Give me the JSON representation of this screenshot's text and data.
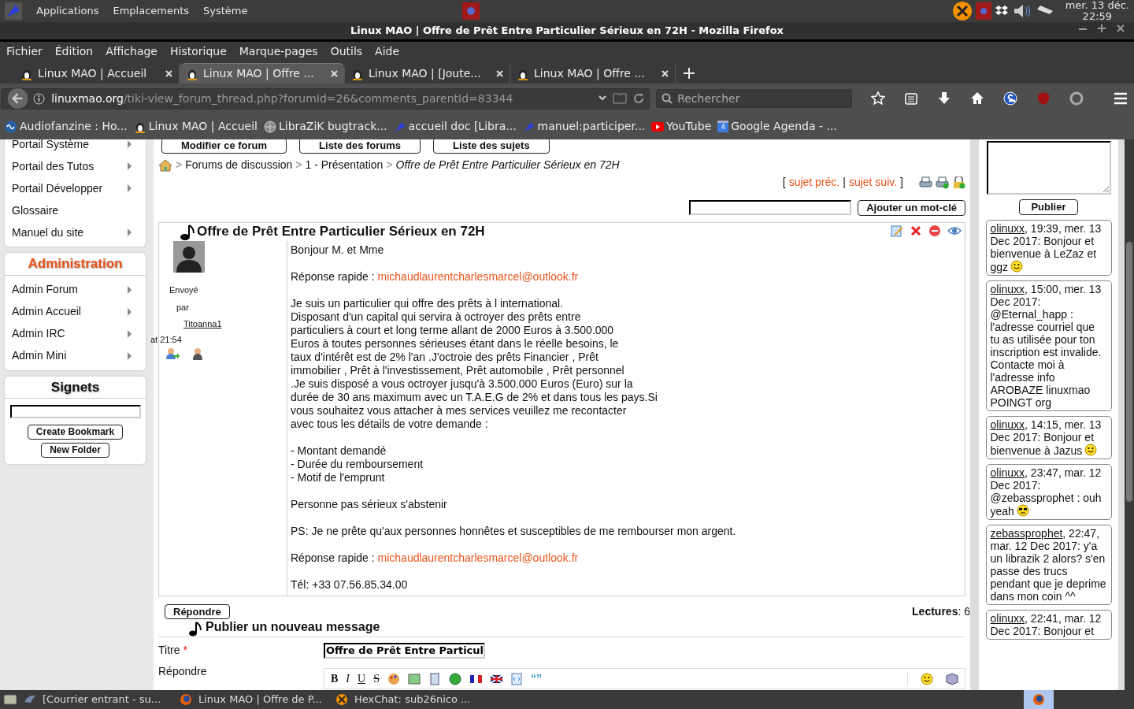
{
  "top_panel": {
    "menus": [
      "Applications",
      "Emplacements",
      "Système"
    ],
    "clock": {
      "day": "mer. 13 déc.",
      "time": "22:59"
    }
  },
  "window": {
    "title": "Linux MAO | Offre de Prêt Entre Particulier Sérieux en 72H - Mozilla Firefox"
  },
  "menubar": [
    "Fichier",
    "Édition",
    "Affichage",
    "Historique",
    "Marque-pages",
    "Outils",
    "Aide"
  ],
  "tabs": [
    {
      "label": "Linux MAO | Accueil",
      "selected": false
    },
    {
      "label": "Linux MAO | Offre ...",
      "selected": true
    },
    {
      "label": "Linux MAO | [Joute...",
      "selected": false
    },
    {
      "label": "Linux MAO | Offre ...",
      "selected": false
    }
  ],
  "address": {
    "domain": "linuxmao.org",
    "path": "/tiki-view_forum_thread.php?forumId=26&comments_parentId=83344"
  },
  "search": {
    "placeholder": "Rechercher"
  },
  "bookmarks": [
    {
      "label": "Audiofanzine : Ho...",
      "kind": "wave"
    },
    {
      "label": "Linux MAO | Accueil",
      "kind": "tux"
    },
    {
      "label": "LibraZiK bugtrack...",
      "kind": "globe"
    },
    {
      "label": "accueil doc [Libra...",
      "kind": "lzk"
    },
    {
      "label": "manuel:participer...",
      "kind": "lzk"
    },
    {
      "label": "YouTube",
      "kind": "play"
    },
    {
      "label": "Google Agenda - ...",
      "kind": "calendar",
      "icon_text": "4"
    }
  ],
  "sidebar": {
    "menu": [
      {
        "label": "Portail Système",
        "submenu": true
      },
      {
        "label": "Portail des Tutos",
        "submenu": true
      },
      {
        "label": "Portail Développer",
        "submenu": true
      },
      {
        "label": "Glossaire",
        "submenu": false
      },
      {
        "label": "Manuel du site",
        "submenu": true
      }
    ],
    "admin": {
      "title": "Administration",
      "items": [
        {
          "label": "Admin Forum",
          "submenu": true
        },
        {
          "label": "Admin Accueil",
          "submenu": true
        },
        {
          "label": "Admin IRC",
          "submenu": true
        },
        {
          "label": "Admin Mini",
          "submenu": true
        }
      ]
    },
    "signets": {
      "title": "Signets",
      "buttons": [
        "Create Bookmark",
        "New Folder"
      ]
    }
  },
  "forum_buttons": [
    "Modifier ce forum",
    "Liste des forums",
    "Liste des sujets"
  ],
  "breadcrumb": [
    {
      "separator": ">",
      "label": "Forums de discussion"
    },
    {
      "separator": ">",
      "label": "1 - Présentation"
    },
    {
      "separator": ">",
      "label": "Offre de Prêt Entre Particulier Sérieux en 72H"
    }
  ],
  "topic_nav": {
    "open": "[",
    "links": [
      "sujet préc.",
      "sujet suiv."
    ],
    "separator": "|",
    "close": "]"
  },
  "keyword": {
    "button": "Ajouter un mot-clé"
  },
  "post": {
    "title": "Offre de Prêt Entre Particulier Sérieux en 72H",
    "sent": "Envoyé",
    "by": "par",
    "author": "Titoanna1",
    "time": "at 21:54",
    "paragraphs": [
      {
        "lines": [
          "Bonjour M. et Mme"
        ]
      },
      {
        "lines": [
          "Réponse rapide : "
        ],
        "link": "michaudlaurentcharlesmarcel@outlook.fr"
      },
      {
        "lines": [
          "Je suis un particulier qui offre des prêts à l international.",
          "Disposant d'un capital qui servira à octroyer des prêts entre",
          "particuliers à court et long terme allant de 2000 Euros à 3.500.000",
          "Euros à toutes personnes sérieuses étant dans le réelle besoins, le",
          "taux d'intérêt est de 2% l'an .J'octroie des prêts Financier , Prêt",
          "immobilier , Prêt à l'investissement, Prêt automobile , Prêt personnel",
          ".Je suis disposé a vous octroyer jusqu'à 3.500.000 Euros (Euro) sur la",
          "durée de 30 ans maximum avec un T.A.E.G de 2% et dans tous les pays.Si",
          "vous souhaitez vous attacher à mes services veuillez me recontacter",
          "avec tous les détails de votre demande :"
        ]
      },
      {
        "lines": [
          "- Montant demandé",
          "- Durée du remboursement",
          "- Motif de l'emprunt"
        ]
      },
      {
        "lines": [
          "Personne pas sérieux s'abstenir"
        ]
      },
      {
        "lines": [
          "PS: Je ne prête qu'aux personnes honnêtes et susceptibles de me rembourser mon argent."
        ]
      },
      {
        "lines": [
          "Réponse rapide : "
        ],
        "link": "michaudlaurentcharlesmarcel@outlook.fr"
      },
      {
        "lines": [
          "Tél: +33 07.56.85.34.00"
        ]
      }
    ]
  },
  "reply_button": "Répondre",
  "reads": {
    "label": "Lectures",
    "value": ": 6"
  },
  "new_message": {
    "heading": "Publier un nouveau message",
    "title_label": "Titre",
    "required": "*",
    "title_value": "Offre de Prêt Entre Particul",
    "reply_label": "Répondre",
    "format_buttons": [
      "B",
      "I",
      "U",
      "S"
    ],
    "quote_glyph": "“”"
  },
  "shoutbox": {
    "button": "Publier",
    "messages": [
      {
        "author": "olinuxx",
        "text": ", 19:39, mer. 13 Dec 2017: Bonjour et bienvenue à LeZaz et ggz",
        "kind": "smile"
      },
      {
        "author": "olinuxx",
        "text": ", 15:00, mer. 13 Dec 2017: @Eternal_happ : l'adresse courriel que tu as utilisée pour ton inscription est invalide. Contacte moi à l'adresse info AROBAZE linuxmao POINGT org",
        "kind": "plain"
      },
      {
        "author": "olinuxx",
        "text": ", 14:15, mer. 13 Dec 2017: Bonjour et bienvenue à Jazus",
        "kind": "smile"
      },
      {
        "author": "olinuxx",
        "text": ", 23:47, mar. 12 Dec 2017: @zebassprophet : ouh yeah",
        "kind": "cool"
      },
      {
        "author": "zebassprophet",
        "text": ", 22:47, mar. 12 Dec 2017: y'a un librazik 2 alors? s'en passe des trucs pendant que je deprime dans mon coin ^^",
        "kind": "plain"
      },
      {
        "author": "olinuxx",
        "text": ", 22:41, mar. 12 Dec 2017: Bonjour et",
        "kind": "plain"
      }
    ]
  },
  "taskbar": [
    {
      "label": "[Courrier entrant - su...",
      "kind": "mail",
      "selected": false
    },
    {
      "label": "Linux MAO | Offre de P...",
      "kind": "firefox",
      "selected": false
    },
    {
      "label": "HexChat: sub26nico ...",
      "kind": "hexchat",
      "selected": false
    }
  ]
}
